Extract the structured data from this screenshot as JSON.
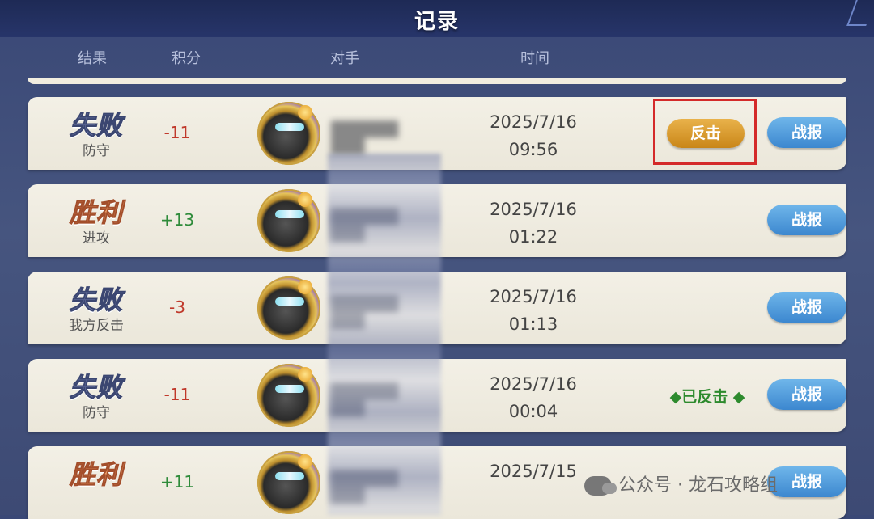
{
  "title": "记录",
  "columns": [
    "结果",
    "积分",
    "对手",
    "时间"
  ],
  "rows": [
    {
      "result": "失败",
      "result_type": "lose",
      "mode": "防守",
      "score": "-11",
      "score_sign": "neg",
      "opponent": "██████ ███",
      "date": "2025/7/16",
      "time": "09:56",
      "action": "反击",
      "action_type": "counter",
      "report": "战报"
    },
    {
      "result": "胜利",
      "result_type": "win",
      "mode": "进攻",
      "score": "+13",
      "score_sign": "pos",
      "opponent": "██████ ███",
      "date": "2025/7/16",
      "time": "01:22",
      "action": "",
      "action_type": "none",
      "report": "战报"
    },
    {
      "result": "失败",
      "result_type": "lose",
      "mode": "我方反击",
      "score": "-3",
      "score_sign": "neg",
      "opponent": "██████ ███",
      "date": "2025/7/16",
      "time": "01:13",
      "action": "",
      "action_type": "none",
      "report": "战报"
    },
    {
      "result": "失败",
      "result_type": "lose",
      "mode": "防守",
      "score": "-11",
      "score_sign": "neg",
      "opponent": "██████ ███",
      "date": "2025/7/16",
      "time": "00:04",
      "action": "◆已反击 ◆",
      "action_type": "done",
      "report": "战报"
    },
    {
      "result": "胜利",
      "result_type": "win",
      "mode": "",
      "score": "+11",
      "score_sign": "pos",
      "opponent": "██████ ███",
      "date": "2025/7/15",
      "time": "",
      "action": "",
      "action_type": "none",
      "report": "战报"
    }
  ],
  "watermark": "公众号 · 龙石攻略组",
  "colors": {
    "accent_blue": "#3c87cf",
    "counter_gold": "#c98618",
    "highlight_red": "#d42a2a",
    "win": "#2e8b3a",
    "lose": "#c0392b"
  }
}
